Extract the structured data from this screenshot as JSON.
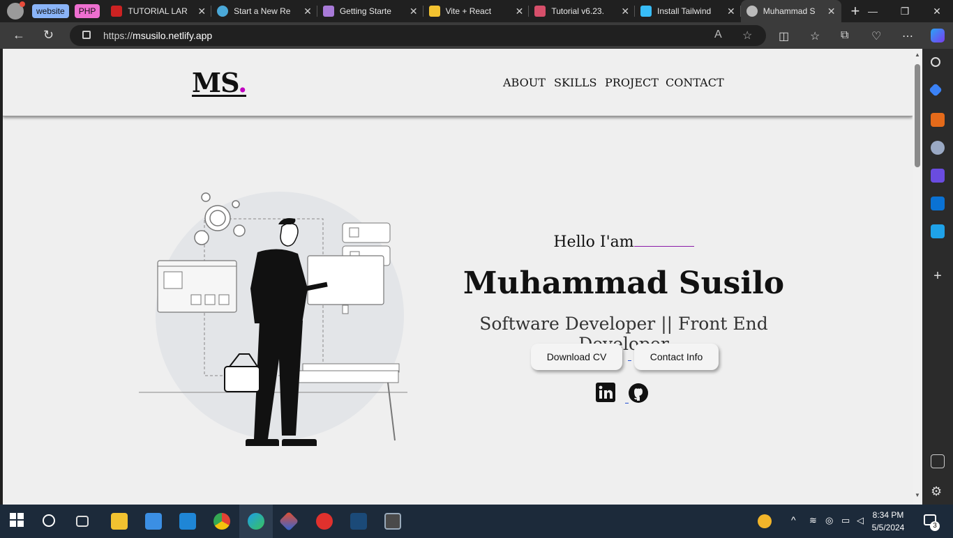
{
  "browser": {
    "tab_groups": [
      {
        "label": "website",
        "color": "#8ab4f8"
      },
      {
        "label": "PHP",
        "color": "#ee6fd0"
      }
    ],
    "tabs": [
      {
        "label": "TUTORIAL LAR",
        "icon": "youtube-icon",
        "color": "#cc2222"
      },
      {
        "label": "Start a New Re",
        "icon": "react-icon",
        "color": "#4aa8d8"
      },
      {
        "label": "Getting Starte",
        "icon": "vite-icon",
        "color": "#a87ad8"
      },
      {
        "label": "Vite + React",
        "icon": "vite-icon",
        "color": "#f2c230"
      },
      {
        "label": "Tutorial v6.23.",
        "icon": "react-router-icon",
        "color": "#d64f6a"
      },
      {
        "label": "Install Tailwind",
        "icon": "tailwind-icon",
        "color": "#38bdf8"
      },
      {
        "label": "Muhammad S",
        "icon": "avatar-icon",
        "color": "#bbb",
        "active": true
      }
    ],
    "url_prefix": "https://",
    "url_host": "msusilo.netlify.app"
  },
  "site": {
    "logo_text": "MS",
    "logo_dot": ".",
    "nav": [
      "ABOUT",
      "SKILLS",
      "PROJECT",
      "CONTACT"
    ],
    "hello": "Hello I'am",
    "name": "Muhammad Susilo",
    "role": "Software Developer || Front End Developer",
    "buttons": {
      "download": "Download CV",
      "contact": "Contact Info"
    },
    "social": [
      "linkedin-icon",
      "github-icon"
    ]
  },
  "taskbar": {
    "time": "8:34 PM",
    "date": "5/5/2024",
    "notifications": "3"
  }
}
